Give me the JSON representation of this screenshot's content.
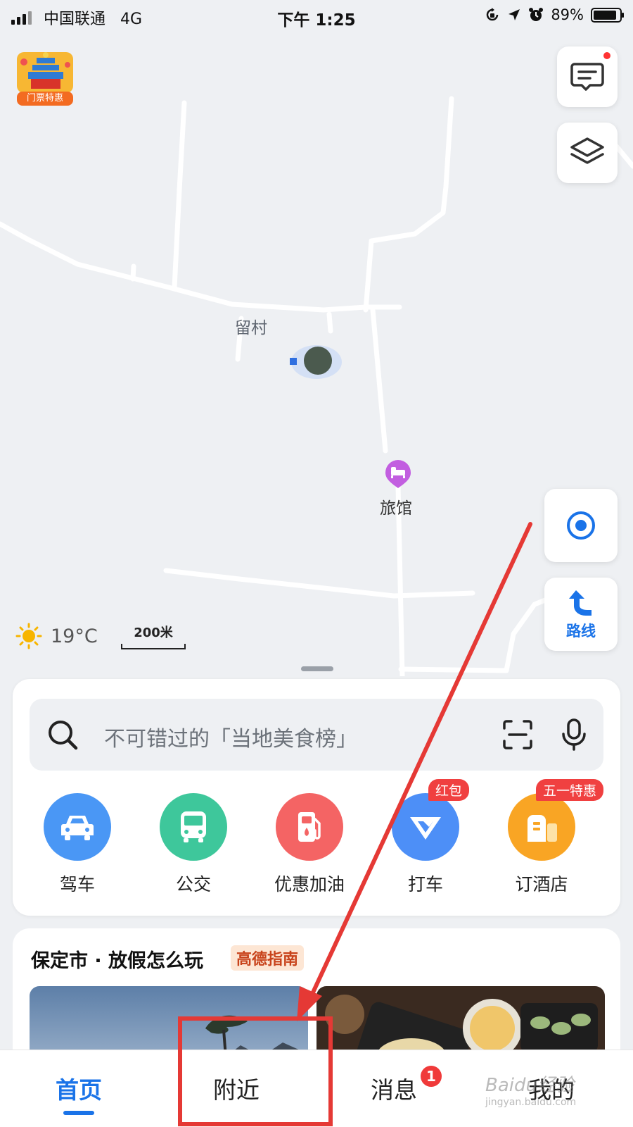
{
  "status_bar": {
    "carrier": "中国联通",
    "network": "4G",
    "time": "下午 1:25",
    "battery_percent": "89%",
    "battery_level": 0.89,
    "icons": [
      "signal-icon",
      "rotation-lock-icon",
      "location-arrow-icon",
      "alarm-icon",
      "battery-icon"
    ]
  },
  "map": {
    "promo_badge_label": "门票特惠",
    "village_label": "留村",
    "hotel_label": "旅馆",
    "weather_temp": "19°C",
    "scale_label": "200米",
    "route_label": "路线"
  },
  "search": {
    "placeholder": "不可错过的「当地美食榜」"
  },
  "quick_actions": [
    {
      "label": "驾车",
      "color": "#4a97f5",
      "icon": "car-icon"
    },
    {
      "label": "公交",
      "color": "#3ec79b",
      "icon": "bus-icon"
    },
    {
      "label": "优惠加油",
      "color": "#f46464",
      "icon": "fuel-icon"
    },
    {
      "label": "打车",
      "color": "#4d8ff7",
      "icon": "taxi-icon",
      "badge": "红包"
    },
    {
      "label": "订酒店",
      "color": "#f9a524",
      "icon": "hotel-icon",
      "badge": "五一特惠"
    }
  ],
  "guide": {
    "title": "保定市 · 放假怎么玩",
    "tag": "高德指南"
  },
  "bottom_nav": [
    {
      "label": "首页",
      "active": true
    },
    {
      "label": "附近",
      "active": false
    },
    {
      "label": "消息",
      "active": false,
      "badge": "1"
    },
    {
      "label": "我的",
      "active": false
    }
  ],
  "watermark": {
    "main": "Baidu经验",
    "sub": "jingyan.baidu.com"
  },
  "colors": {
    "accent": "#1a73e8",
    "annotation": "#e53935",
    "map_bg": "#eef0f3"
  }
}
